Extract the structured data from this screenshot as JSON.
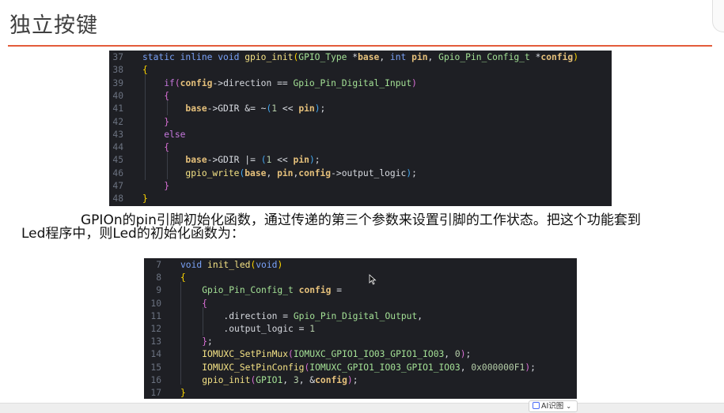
{
  "slide": {
    "title": "独立按键",
    "description_line1": "GPIOn的pin引脚初始化函数，通过传递的第三个参数来设置引脚的工作状态。把这个功能套到",
    "description_line2": "Led程序中，则Led的初始化函数为："
  },
  "code_block_1": {
    "lines": [
      {
        "num": "37",
        "tokens": [
          [
            "k",
            "static "
          ],
          [
            "k",
            "inline "
          ],
          [
            "k",
            "void "
          ],
          [
            "f",
            "gpio_init"
          ],
          [
            "br1",
            "("
          ],
          [
            "t",
            "GPIO_Type "
          ],
          [
            "o",
            "*"
          ],
          [
            "p",
            "base"
          ],
          [
            "o",
            ", "
          ],
          [
            "k",
            "int "
          ],
          [
            "p",
            "pin"
          ],
          [
            "o",
            ", "
          ],
          [
            "t",
            "Gpio_Pin_Config_t "
          ],
          [
            "o",
            "*"
          ],
          [
            "p",
            "config"
          ],
          [
            "br1",
            ")"
          ]
        ]
      },
      {
        "num": "38",
        "tokens": [
          [
            "br1",
            "{"
          ]
        ]
      },
      {
        "num": "39",
        "tokens": [
          [
            "o",
            "    "
          ],
          [
            "kw2",
            "if"
          ],
          [
            "br2",
            "("
          ],
          [
            "p",
            "config"
          ],
          [
            "o",
            "->"
          ],
          [
            "v",
            "direction"
          ],
          [
            "o",
            " == "
          ],
          [
            "t",
            "Gpio_Pin_Digital_Input"
          ],
          [
            "br2",
            ")"
          ]
        ]
      },
      {
        "num": "40",
        "tokens": [
          [
            "o",
            "    "
          ],
          [
            "br2",
            "{"
          ]
        ]
      },
      {
        "num": "41",
        "tokens": [
          [
            "o",
            "        "
          ],
          [
            "p",
            "base"
          ],
          [
            "o",
            "->"
          ],
          [
            "v",
            "GDIR"
          ],
          [
            "o",
            " &= ~"
          ],
          [
            "br3",
            "("
          ],
          [
            "n",
            "1"
          ],
          [
            "o",
            " << "
          ],
          [
            "p",
            "pin"
          ],
          [
            "br3",
            ")"
          ],
          [
            "o",
            ";"
          ]
        ]
      },
      {
        "num": "42",
        "tokens": [
          [
            "o",
            "    "
          ],
          [
            "br2",
            "}"
          ]
        ]
      },
      {
        "num": "43",
        "tokens": [
          [
            "o",
            "    "
          ],
          [
            "kw2",
            "else"
          ]
        ]
      },
      {
        "num": "44",
        "tokens": [
          [
            "o",
            "    "
          ],
          [
            "br2",
            "{"
          ]
        ]
      },
      {
        "num": "45",
        "tokens": [
          [
            "o",
            "        "
          ],
          [
            "p",
            "base"
          ],
          [
            "o",
            "->"
          ],
          [
            "v",
            "GDIR"
          ],
          [
            "o",
            " |= "
          ],
          [
            "br3",
            "("
          ],
          [
            "n",
            "1"
          ],
          [
            "o",
            " << "
          ],
          [
            "p",
            "pin"
          ],
          [
            "br3",
            ")"
          ],
          [
            "o",
            ";"
          ]
        ]
      },
      {
        "num": "46",
        "tokens": [
          [
            "o",
            "        "
          ],
          [
            "f",
            "gpio_write"
          ],
          [
            "br3",
            "("
          ],
          [
            "p",
            "base"
          ],
          [
            "o",
            ", "
          ],
          [
            "p",
            "pin"
          ],
          [
            "o",
            ","
          ],
          [
            "p",
            "config"
          ],
          [
            "o",
            "->"
          ],
          [
            "v",
            "output_logic"
          ],
          [
            "br3",
            ")"
          ],
          [
            "o",
            ";"
          ]
        ]
      },
      {
        "num": "47",
        "tokens": [
          [
            "o",
            "    "
          ],
          [
            "br2",
            "}"
          ]
        ]
      },
      {
        "num": "48",
        "tokens": [
          [
            "br1",
            "}"
          ]
        ]
      }
    ]
  },
  "code_block_2": {
    "lines": [
      {
        "num": "7",
        "tokens": [
          [
            "k",
            "void "
          ],
          [
            "f",
            "init_led"
          ],
          [
            "br1",
            "("
          ],
          [
            "k",
            "void"
          ],
          [
            "br1",
            ")"
          ]
        ]
      },
      {
        "num": "8",
        "tokens": [
          [
            "br1",
            "{"
          ]
        ]
      },
      {
        "num": "9",
        "tokens": [
          [
            "o",
            "    "
          ],
          [
            "t",
            "Gpio_Pin_Config_t "
          ],
          [
            "p",
            "config"
          ],
          [
            "o",
            " ="
          ]
        ]
      },
      {
        "num": "10",
        "tokens": [
          [
            "o",
            "    "
          ],
          [
            "br2",
            "{"
          ]
        ]
      },
      {
        "num": "11",
        "tokens": [
          [
            "o",
            "        ."
          ],
          [
            "v",
            "direction"
          ],
          [
            "o",
            " = "
          ],
          [
            "t",
            "Gpio_Pin_Digital_Output"
          ],
          [
            "o",
            ","
          ]
        ]
      },
      {
        "num": "12",
        "tokens": [
          [
            "o",
            "        ."
          ],
          [
            "v",
            "output_logic"
          ],
          [
            "o",
            " = "
          ],
          [
            "n",
            "1"
          ]
        ]
      },
      {
        "num": "13",
        "tokens": [
          [
            "o",
            "    "
          ],
          [
            "br2",
            "}"
          ],
          [
            "o",
            ";"
          ]
        ]
      },
      {
        "num": "14",
        "tokens": [
          [
            "o",
            "    "
          ],
          [
            "f",
            "IOMUXC_SetPinMux"
          ],
          [
            "br2",
            "("
          ],
          [
            "t",
            "IOMUXC_GPIO1_IO03_GPIO1_IO03"
          ],
          [
            "o",
            ", "
          ],
          [
            "n",
            "0"
          ],
          [
            "br2",
            ")"
          ],
          [
            "o",
            ";"
          ]
        ]
      },
      {
        "num": "15",
        "tokens": [
          [
            "o",
            "    "
          ],
          [
            "f",
            "IOMUXC_SetPinConfig"
          ],
          [
            "br2",
            "("
          ],
          [
            "t",
            "IOMUXC_GPIO1_IO03_GPIO1_IO03"
          ],
          [
            "o",
            ", "
          ],
          [
            "n",
            "0x000000F1"
          ],
          [
            "br2",
            ")"
          ],
          [
            "o",
            ";"
          ]
        ]
      },
      {
        "num": "16",
        "tokens": [
          [
            "o",
            "    "
          ],
          [
            "f",
            "gpio_init"
          ],
          [
            "br2",
            "("
          ],
          [
            "t",
            "GPIO1"
          ],
          [
            "o",
            ", "
          ],
          [
            "n",
            "3"
          ],
          [
            "o",
            ", &"
          ],
          [
            "p",
            "config"
          ],
          [
            "br2",
            ")"
          ],
          [
            "o",
            ";"
          ]
        ]
      },
      {
        "num": "17",
        "tokens": [
          [
            "br1",
            "}"
          ]
        ]
      }
    ]
  },
  "toolbar": {
    "ai_button_label": "AI识图",
    "ai_button_icon": "ai-scan-icon",
    "dropdown_icon": "chevron-down-icon"
  },
  "colors": {
    "title_rule": "#e35b3a",
    "code_background": "#1e1f24"
  }
}
